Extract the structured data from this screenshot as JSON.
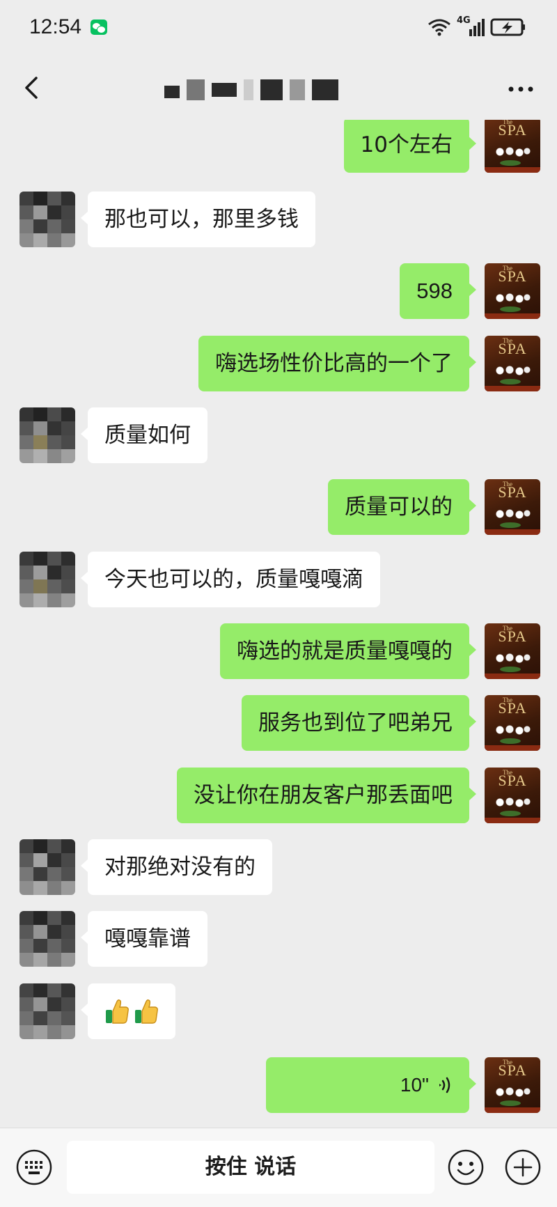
{
  "status_bar": {
    "time": "12:54",
    "network": "4G",
    "icons": [
      "wechat-notification-icon",
      "wifi-icon",
      "signal-icon",
      "battery-charging-icon"
    ]
  },
  "header": {
    "back_icon": "chevron-left-icon",
    "title_redacted": true,
    "more_icon": "ellipsis-icon"
  },
  "messages": [
    {
      "from": "self",
      "text": "10个左右"
    },
    {
      "from": "other",
      "text": "那也可以，那里多钱"
    },
    {
      "from": "self",
      "text": "598"
    },
    {
      "from": "self",
      "text": "嗨选场性价比高的一个了"
    },
    {
      "from": "other",
      "text": "质量如何"
    },
    {
      "from": "self",
      "text": "质量可以的"
    },
    {
      "from": "other",
      "text": "今天也可以的，质量嘎嘎滴"
    },
    {
      "from": "self",
      "text": "嗨选的就是质量嘎嘎的"
    },
    {
      "from": "self",
      "text": "服务也到位了吧弟兄"
    },
    {
      "from": "self",
      "text": "没让你在朋友客户那丢面吧"
    },
    {
      "from": "other",
      "text": "对那绝对没有的"
    },
    {
      "from": "other",
      "text": "嘎嘎靠谱"
    },
    {
      "from": "other",
      "emoji": [
        "thumbs-up-icon",
        "thumbs-up-icon"
      ]
    },
    {
      "from": "self",
      "voice_duration": "10\""
    }
  ],
  "avatars": {
    "self": {
      "text": "SPA",
      "small_text": "The"
    },
    "other": {
      "redacted": true
    }
  },
  "input_bar": {
    "hold_to_talk_label": "按住 说话",
    "left_icon": "keyboard-icon",
    "emoji_icon": "smiley-icon",
    "plus_icon": "plus-circle-icon"
  },
  "colors": {
    "background": "#ededed",
    "self_bubble": "#95ec69",
    "other_bubble": "#ffffff",
    "accent": "#07c160"
  }
}
